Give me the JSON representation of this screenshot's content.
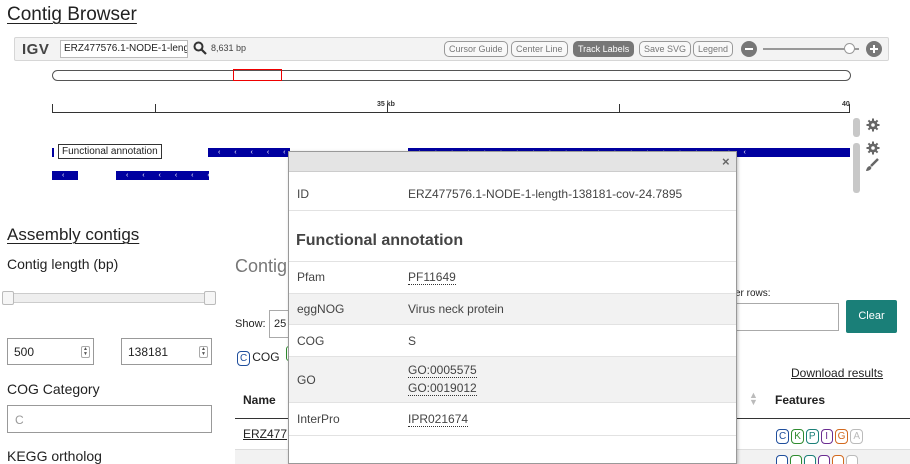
{
  "page": {
    "title": "Contig Browser"
  },
  "igv": {
    "logo": "IGV",
    "locus": "ERZ477576.1-NODE-1-length",
    "locus_size": "8,631 bp",
    "buttons": {
      "cursor_guide": "Cursor Guide",
      "center_line": "Center Line",
      "track_labels": "Track Labels",
      "save_svg": "Save SVG",
      "legend": "Legend"
    },
    "ruler": {
      "label_mid": "35 kb",
      "label_end": "40"
    },
    "track_label": "Functional annotation",
    "feature_glyph": "‹ ‹ ‹ ‹ ‹ ‹ ‹ ‹ ‹ ‹ ‹ ‹ ‹ ‹ ‹ ‹ ‹ ‹ ‹ ‹ ‹"
  },
  "popup": {
    "close": "×",
    "id_key": "ID",
    "id_value": "ERZ477576.1-NODE-1-length-138181-cov-24.7895",
    "section_title": "Functional annotation",
    "rows": [
      {
        "key": "Pfam",
        "values": [
          "PF11649"
        ]
      },
      {
        "key": "eggNOG",
        "values": [
          "Virus neck protein"
        ]
      },
      {
        "key": "COG",
        "values": [
          "S"
        ]
      },
      {
        "key": "GO",
        "values": [
          "GO:0005575",
          "GO:0019012"
        ]
      },
      {
        "key": "InterPro",
        "values": [
          "IPR021674"
        ]
      }
    ]
  },
  "filters": {
    "heading": "Assembly contigs",
    "length_label": "Contig length (bp)",
    "min_length": "500",
    "max_length": "138181",
    "cog_label": "COG Category",
    "cog_placeholder": "C",
    "kegg_label": "KEGG ortholog"
  },
  "table": {
    "title": "Contig",
    "show_label": "Show:",
    "show_value": "25",
    "filter_label": "er rows:",
    "clear_label": "Clear",
    "cog_tag": {
      "letter": "C",
      "label": "COG"
    },
    "download_label": "Download results",
    "columns": {
      "name": "Name",
      "features": "Features"
    },
    "row1_name": "ERZ477",
    "feature_tags": [
      "C",
      "K",
      "P",
      "I",
      "G",
      "A"
    ],
    "feature_tag_colors": [
      "#1f4e9c",
      "#2e8b2e",
      "#1a7f78",
      "#6a2c91",
      "#d2691e",
      "#bbbbbb"
    ]
  }
}
